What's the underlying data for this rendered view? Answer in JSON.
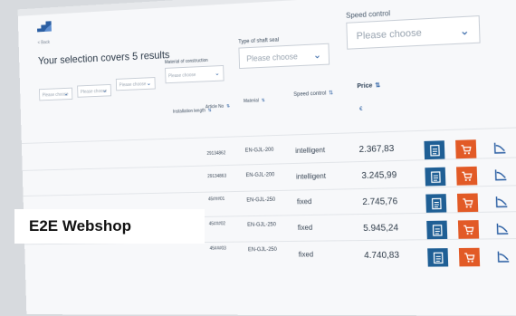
{
  "header": {
    "back_label": "< Back",
    "results_title": "Your selection covers 5 results"
  },
  "filters": {
    "placeholder": "Please choose",
    "construction_label": "Material of construction",
    "shaft_seal_label": "Type of shaft seal",
    "speed_control_label": "Speed control"
  },
  "columns": {
    "installation_length": "Installation length",
    "article_no": "Article No",
    "material": "Material",
    "speed_control": "Speed control",
    "price": "Price"
  },
  "rows": [
    {
      "article_no": "29134862",
      "material": "EN-GJL-200",
      "speed_control": "intelligent",
      "price": "2.367,83"
    },
    {
      "article_no": "29134863",
      "material": "EN-GJL-200",
      "speed_control": "intelligent",
      "price": "3.245,99"
    },
    {
      "article_no": "45###01",
      "material": "EN-GJL-250",
      "speed_control": "fixed",
      "price": "2.745,76"
    },
    {
      "article_no": "45###02",
      "material": "EN-GJL-250",
      "speed_control": "fixed",
      "price": "5.945,24"
    },
    {
      "article_no": "45###03",
      "material": "EN-GJL-250",
      "speed_control": "fixed",
      "price": "4.740,83"
    }
  ],
  "overlay": {
    "brand_label": "E2E Webshop"
  },
  "icons": {
    "datasheet": "document-icon",
    "cart": "cart-icon",
    "curve": "pump-curve-icon"
  },
  "colors": {
    "datasheet_button": "#1f5f95",
    "cart_button": "#e25a26",
    "accent": "#2b5fa3"
  }
}
